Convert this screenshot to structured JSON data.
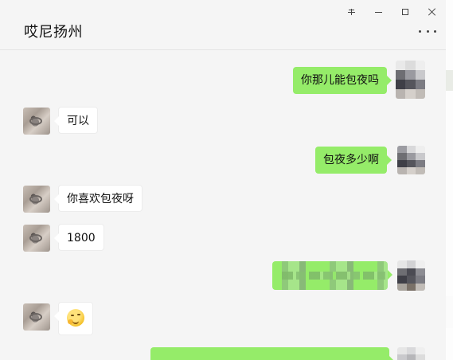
{
  "window": {
    "title": "哎尼扬州",
    "controls": {
      "pin_icon": "pin-icon",
      "minimize_icon": "minimize-icon",
      "maximize_icon": "maximize-icon",
      "close_icon": "close-icon"
    },
    "more_icon": "more-icon"
  },
  "messages": [
    {
      "side": "right",
      "text": "你那儿能包夜吗"
    },
    {
      "side": "left",
      "text": "可以"
    },
    {
      "side": "right",
      "text": "包夜多少啊"
    },
    {
      "side": "left",
      "text": "你喜欢包夜呀"
    },
    {
      "side": "left",
      "text": "1800"
    },
    {
      "side": "right",
      "text": "",
      "redacted": true
    },
    {
      "side": "left",
      "text": "",
      "emoji": "thinking-face"
    },
    {
      "side": "right",
      "text": "",
      "redacted": true
    }
  ],
  "colors": {
    "self_bubble": "#95ec69",
    "other_bubble": "#ffffff",
    "background": "#f5f5f5"
  }
}
